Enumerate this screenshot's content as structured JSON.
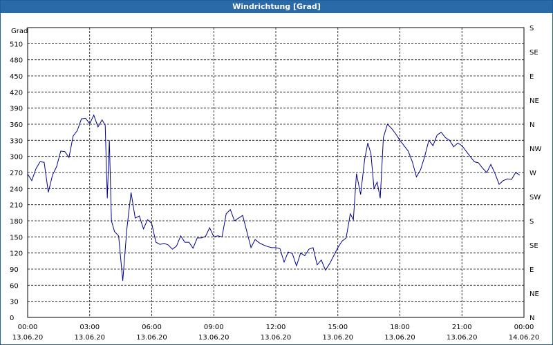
{
  "window": {
    "title": "Windrichtung [Grad]"
  },
  "chart_data": {
    "type": "line",
    "title": "Windrichtung [Grad]",
    "ylabel": "Grad",
    "ylim": [
      0,
      540
    ],
    "y_ticks": [
      0,
      30,
      60,
      90,
      120,
      150,
      180,
      210,
      240,
      270,
      300,
      330,
      360,
      390,
      420,
      450,
      480,
      510
    ],
    "right_axis_labels": [
      "N",
      "NE",
      "E",
      "SE",
      "S",
      "SW",
      "W",
      "NW",
      "N",
      "NE",
      "E",
      "SE",
      "S"
    ],
    "x_ticks": [
      {
        "time": "00:00",
        "date": "13.06.20"
      },
      {
        "time": "03:00",
        "date": "13.06.20"
      },
      {
        "time": "06:00",
        "date": "13.06.20"
      },
      {
        "time": "09:00",
        "date": "13.06.20"
      },
      {
        "time": "12:00",
        "date": "13.06.20"
      },
      {
        "time": "15:00",
        "date": "13.06.20"
      },
      {
        "time": "18:00",
        "date": "13.06.20"
      },
      {
        "time": "21:00",
        "date": "13.06.20"
      },
      {
        "time": "00:00",
        "date": "14.06.20"
      }
    ],
    "grid": true,
    "line_color": "#00008b",
    "series": [
      {
        "x_hours": [
          0,
          0.2,
          0.4,
          0.6,
          0.8,
          1.0,
          1.2,
          1.4,
          1.6,
          1.8,
          2.0,
          2.2,
          2.4,
          2.6,
          2.8,
          3.0,
          3.2,
          3.4,
          3.6,
          3.75,
          3.85,
          3.95,
          4.05,
          4.2,
          4.4,
          4.6,
          4.8,
          5.0,
          5.2,
          5.4,
          5.6,
          5.8,
          6.0,
          6.2,
          6.4,
          6.6,
          6.8,
          7.0,
          7.2,
          7.4,
          7.6,
          7.8,
          8.0,
          8.2,
          8.4,
          8.6,
          8.8,
          9.0,
          9.2,
          9.4,
          9.6,
          9.8,
          10.0,
          10.2,
          10.4,
          10.6,
          10.8,
          11.0,
          11.2,
          11.4,
          11.6,
          11.8,
          12.0,
          12.2,
          12.4,
          12.6,
          12.8,
          13.0,
          13.2,
          13.4,
          13.6,
          13.8,
          14.0,
          14.2,
          14.4,
          14.6,
          14.8,
          15.0,
          15.2,
          15.4,
          15.5,
          15.6,
          15.75,
          15.9,
          16.1,
          16.3,
          16.45,
          16.6,
          16.75,
          16.9,
          17.05,
          17.2,
          17.4,
          17.6,
          17.8,
          18.0,
          18.2,
          18.4,
          18.6,
          18.8,
          19.0,
          19.2,
          19.4,
          19.6,
          19.8,
          20.0,
          20.2,
          20.4,
          20.6,
          20.8,
          21.0,
          21.2,
          21.4,
          21.6,
          21.8,
          22.0,
          22.2,
          22.4,
          22.6,
          22.8,
          23.0,
          23.2,
          23.4,
          23.6,
          23.8
        ],
        "values": [
          267,
          255,
          277,
          290,
          289,
          233,
          265,
          281,
          310,
          309,
          298,
          338,
          348,
          370,
          371,
          361,
          377,
          355,
          368,
          358,
          222,
          330,
          180,
          160,
          152,
          68,
          166,
          233,
          185,
          189,
          165,
          182,
          175,
          140,
          136,
          138,
          135,
          127,
          133,
          152,
          140,
          140,
          129,
          148,
          148,
          151,
          167,
          150,
          152,
          150,
          193,
          201,
          180,
          185,
          190,
          160,
          130,
          145,
          139,
          135,
          132,
          130,
          130,
          128,
          103,
          122,
          119,
          96,
          120,
          115,
          127,
          130,
          98,
          107,
          88,
          100,
          115,
          130,
          142,
          148,
          170,
          193,
          182,
          268,
          229,
          295,
          325,
          305,
          240,
          252,
          222,
          335,
          360,
          352,
          342,
          330,
          320,
          310,
          290,
          262,
          275,
          300,
          330,
          320,
          340,
          345,
          335,
          330,
          318,
          325,
          320,
          310,
          300,
          290,
          288,
          278,
          270,
          285,
          268,
          248,
          255,
          258,
          257,
          270,
          265,
          255,
          250
        ]
      }
    ]
  }
}
